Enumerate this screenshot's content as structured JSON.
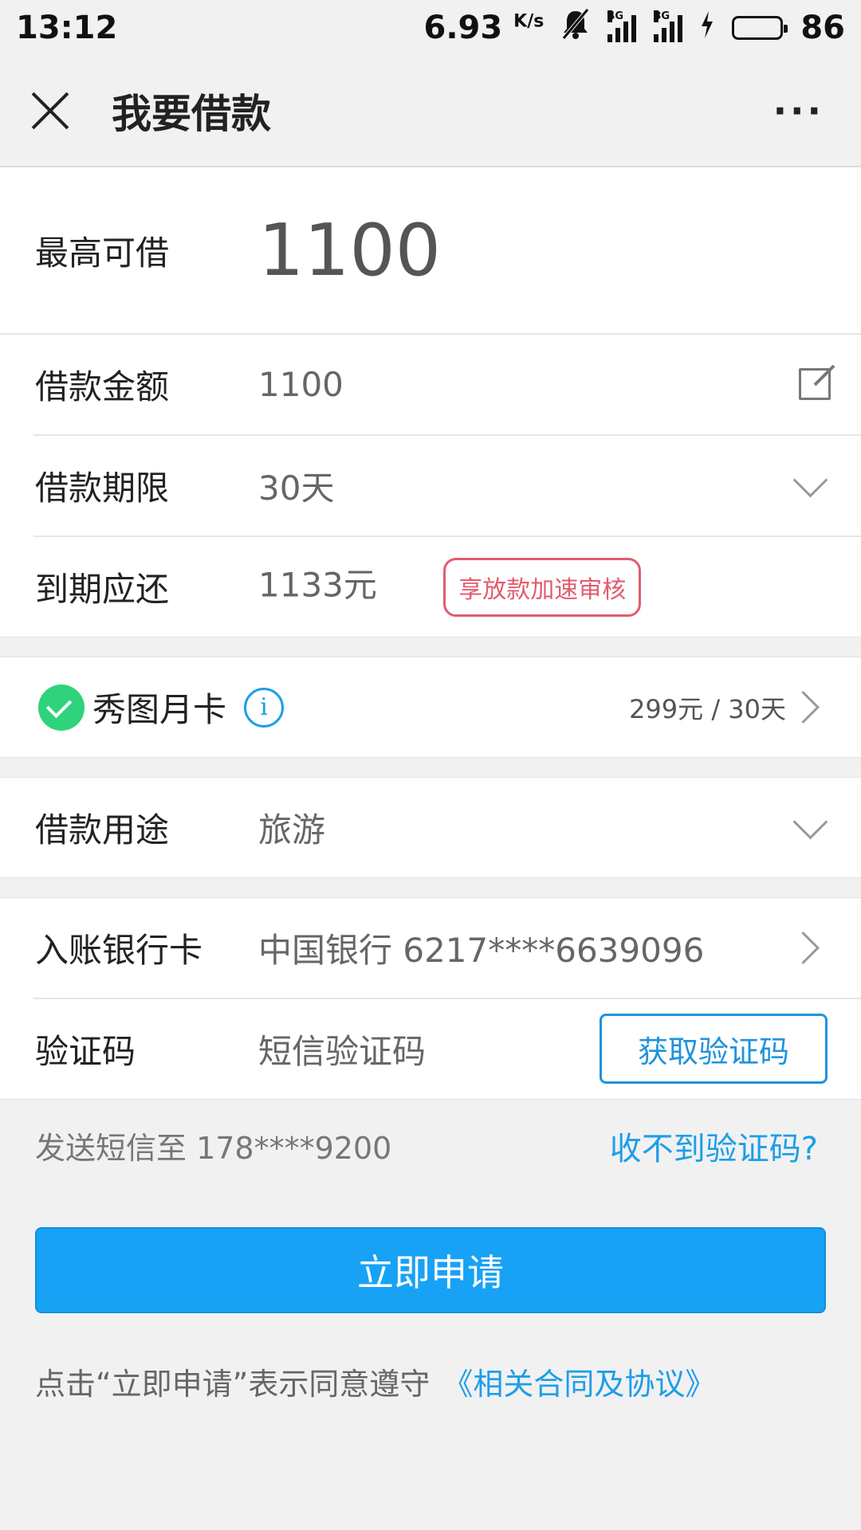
{
  "status_bar": {
    "time": "13:12",
    "speed": "6.93",
    "speed_unit": "K/s",
    "network_1": "4G",
    "network_2": "3G",
    "battery_level": "86"
  },
  "nav": {
    "title": "我要借款",
    "more": "···"
  },
  "max_borrow": {
    "label": "最高可借",
    "value": "1100"
  },
  "loan_amount": {
    "label": "借款金额",
    "value": "1100"
  },
  "loan_term": {
    "label": "借款期限",
    "value": "30天"
  },
  "due_amount": {
    "label": "到期应还",
    "value": "1133元",
    "badge": "享放款加速审核"
  },
  "monthly_card": {
    "label": "秀图月卡",
    "info": "i",
    "price": "299元 / 30天"
  },
  "loan_purpose": {
    "label": "借款用途",
    "value": "旅游"
  },
  "bank_card": {
    "label": "入账银行卡",
    "value": "中国银行 6217****6639096"
  },
  "verify_code": {
    "label": "验证码",
    "placeholder": "短信验证码",
    "button": "获取验证码"
  },
  "sms": {
    "text": "发送短信至 178****9200",
    "link": "收不到验证码?"
  },
  "apply_button": "立即申请",
  "agreement": {
    "text": "点击“立即申请”表示同意遵守",
    "link": "《相关合同及协议》"
  },
  "colors": {
    "accent": "#18a2f5",
    "link": "#1e9ee8",
    "badge": "#e25c6f",
    "check": "#2fd37c"
  }
}
